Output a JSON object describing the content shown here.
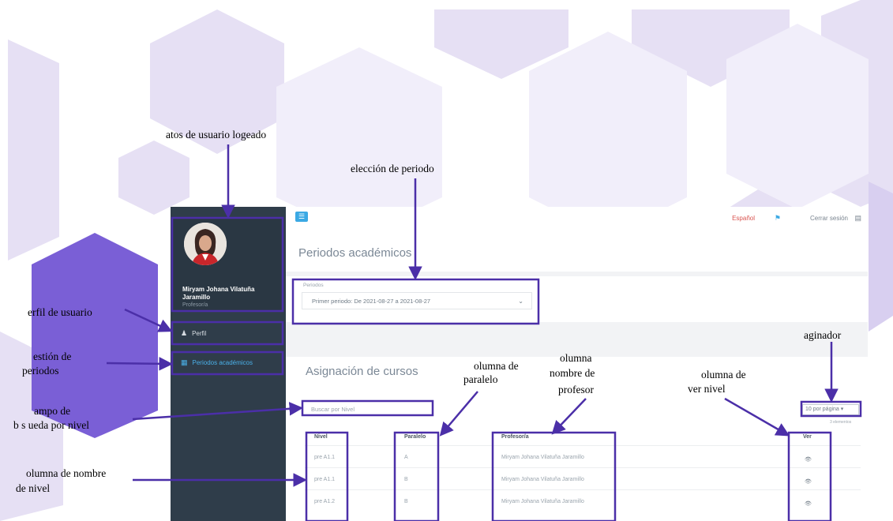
{
  "app": {
    "user": {
      "name": "Miryam Johana Vilatuña Jaramillo",
      "role": "Profesor/a"
    },
    "nav": [
      {
        "label": "Perfil",
        "icon": "user-icon"
      },
      {
        "label": "Periodos académicos",
        "icon": "calendar-icon"
      }
    ],
    "topbar": {
      "language": "Español",
      "logout": "Cerrar sesión"
    },
    "page_title": "Periodos académicos",
    "periods": {
      "label": "Periodos",
      "selected": "Primer periodo: De 2021-08-27 a 2021-08-27"
    },
    "assignment": {
      "title": "Asignación de cursos",
      "search_placeholder": "Buscar por Nivel",
      "per_page": "10 por página",
      "count": "3 elementos",
      "columns": [
        "Nivel",
        "Paralelo",
        "Profesor/a",
        "Ver"
      ],
      "rows": [
        {
          "nivel": "pre A1.1",
          "paralelo": "A",
          "profesor": "Miryam Johana Vilatuña Jaramillo"
        },
        {
          "nivel": "pre A1.1",
          "paralelo": "B",
          "profesor": "Miryam Johana Vilatuña Jaramillo"
        },
        {
          "nivel": "pre A1.2",
          "paralelo": "B",
          "profesor": "Miryam Johana Vilatuña Jaramillo"
        }
      ]
    }
  },
  "annotations": {
    "user_data": "atos de usuario logeado",
    "period_select": "elección de periodo",
    "user_profile": "erfil de usuario",
    "period_mgmt_1": "estión de",
    "period_mgmt_2": "periodos",
    "paginator": "aginador",
    "col_paralelo_1": "olumna de",
    "col_paralelo_2": "paralelo",
    "col_prof_1": "olumna",
    "col_prof_2": "nombre de",
    "col_prof_3": "profesor",
    "col_ver_1": "olumna de",
    "col_ver_2": "ver nivel",
    "search_field_1": "ampo de",
    "search_field_2": "b s ueda por nivel",
    "col_nivel_1": "olumna de nombre",
    "col_nivel_2": "de nivel"
  },
  "colors": {
    "annotation": "#4b2fa8",
    "sidebar": "#2f3d4a",
    "accent": "#3ba9e4",
    "hexagon": "#e4ddf3",
    "hexagon_dark": "#7a5fd6"
  }
}
